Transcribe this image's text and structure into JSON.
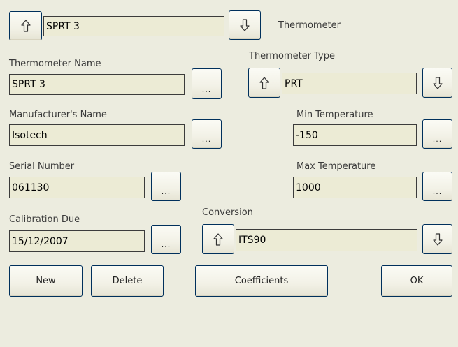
{
  "header": {
    "selector_value": "SPRT 3",
    "title": "Thermometer"
  },
  "icons": {
    "up": "up-arrow-icon",
    "down": "down-arrow-icon"
  },
  "fields": {
    "thermometer_name": {
      "label": "Thermometer Name",
      "value": "SPRT 3",
      "browse": "..."
    },
    "thermometer_type": {
      "label": "Thermometer Type",
      "value": "PRT"
    },
    "manufacturer_name": {
      "label": "Manufacturer's Name",
      "value": "Isotech",
      "browse": "..."
    },
    "min_temperature": {
      "label": "Min Temperature",
      "value": "-150",
      "browse": "..."
    },
    "serial_number": {
      "label": "Serial Number",
      "value": "061130",
      "browse": "..."
    },
    "max_temperature": {
      "label": "Max Temperature",
      "value": "1000",
      "browse": "..."
    },
    "calibration_due": {
      "label": "Calibration Due",
      "value": "15/12/2007",
      "browse": "..."
    },
    "conversion": {
      "label": "Conversion",
      "value": "ITS90"
    }
  },
  "buttons": {
    "new": "New",
    "delete": "Delete",
    "coefficients": "Coefficients",
    "ok": "OK"
  }
}
